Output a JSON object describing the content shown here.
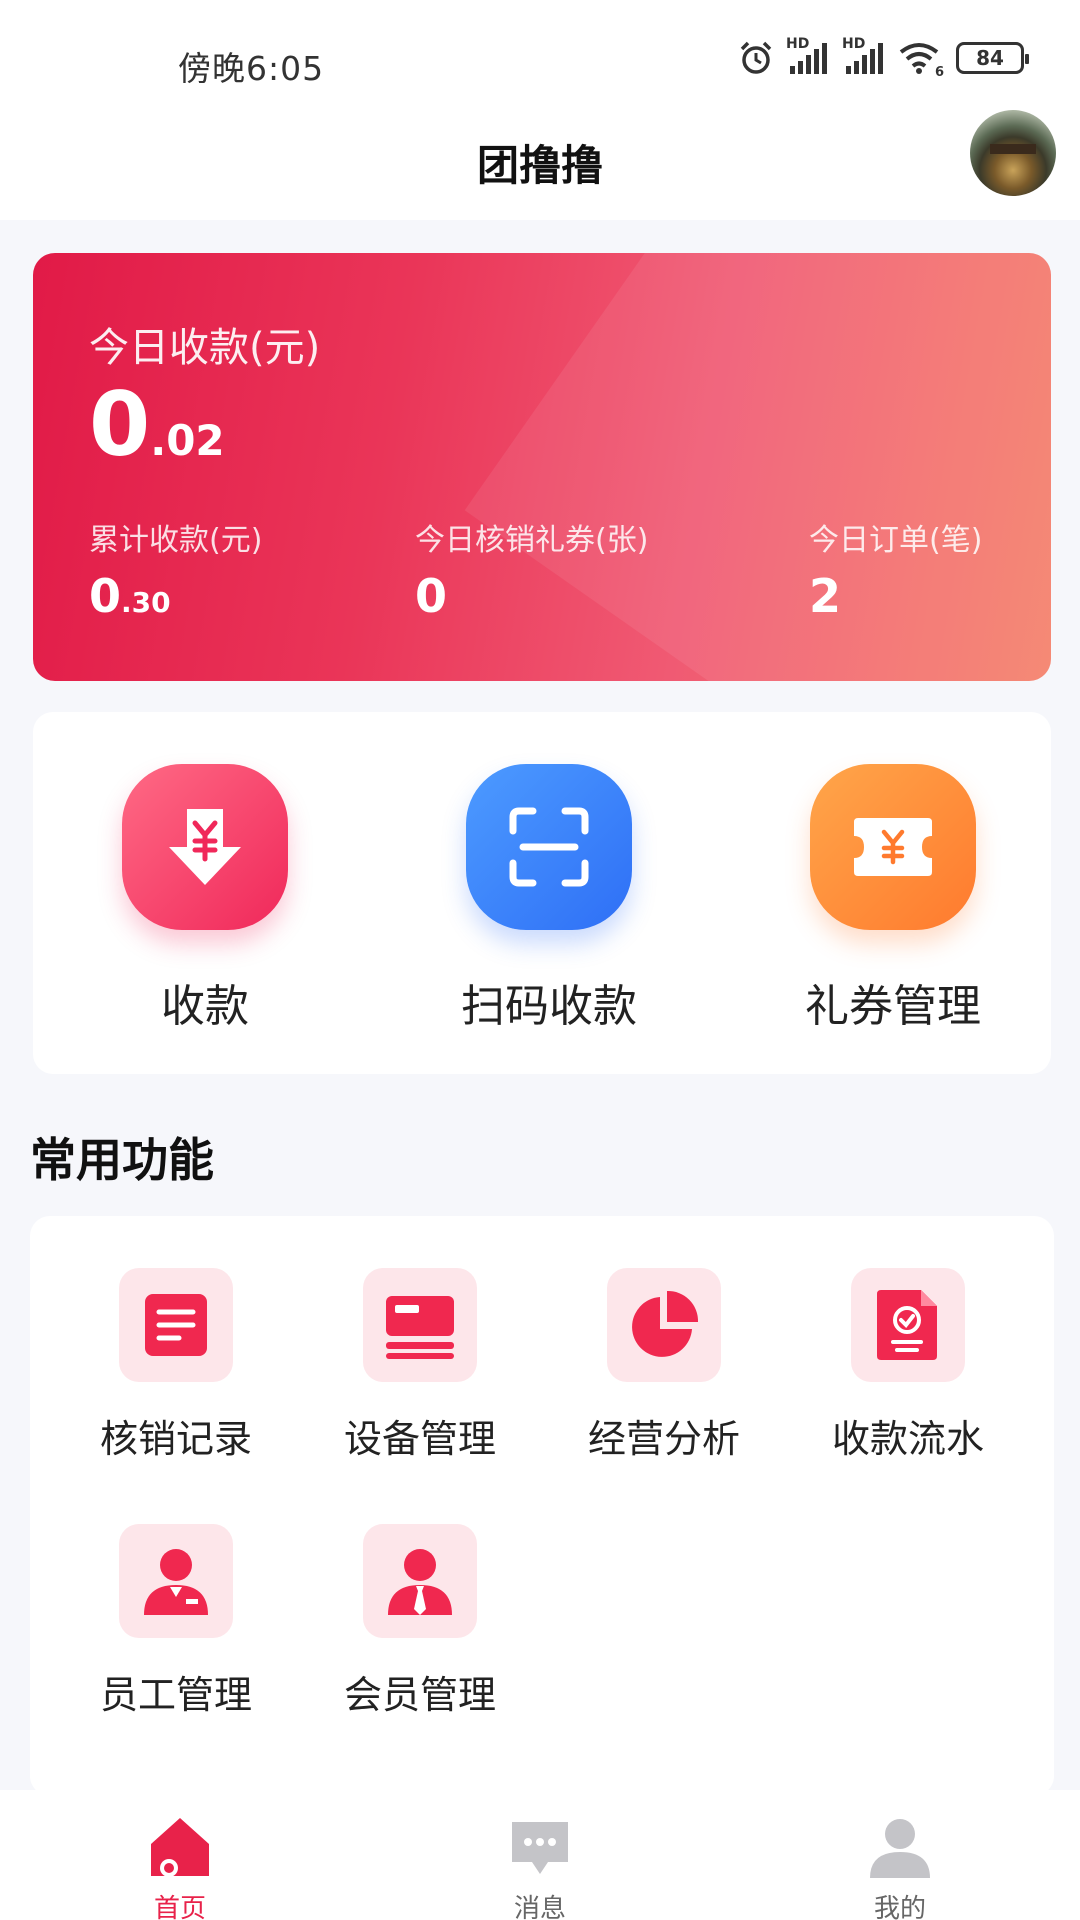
{
  "status_bar": {
    "time": "傍晚6:05",
    "battery": "84",
    "network_label_1": "HD",
    "network_label_2": "HD",
    "wifi_label": "6"
  },
  "header": {
    "title": "团撸撸"
  },
  "revenue": {
    "today_label": "今日收款(元)",
    "today_integer": "0",
    "today_decimal": ".02",
    "stats": [
      {
        "label": "累计收款(元)",
        "integer": "0",
        "decimal": ".30"
      },
      {
        "label": "今日核销礼券(张)",
        "value": "0"
      },
      {
        "label": "今日订单(笔)",
        "value": "2"
      }
    ]
  },
  "quick_actions": [
    {
      "label": "收款",
      "icon": "receive-payment-icon"
    },
    {
      "label": "扫码收款",
      "icon": "scan-icon"
    },
    {
      "label": "礼券管理",
      "icon": "coupon-icon"
    }
  ],
  "section_title": "常用功能",
  "features": [
    {
      "label": "核销记录",
      "icon": "document-icon"
    },
    {
      "label": "设备管理",
      "icon": "card-device-icon"
    },
    {
      "label": "经营分析",
      "icon": "pie-chart-icon"
    },
    {
      "label": "收款流水",
      "icon": "receipt-icon"
    },
    {
      "label": "员工管理",
      "icon": "staff-icon"
    },
    {
      "label": "会员管理",
      "icon": "member-icon"
    }
  ],
  "tab_bar": [
    {
      "label": "首页",
      "icon": "home-icon",
      "active": true
    },
    {
      "label": "消息",
      "icon": "message-icon",
      "active": false
    },
    {
      "label": "我的",
      "icon": "profile-icon",
      "active": false
    }
  ],
  "colors": {
    "accent": "#e8224a",
    "card_gradient_start": "#e11a47",
    "card_gradient_end": "#f5806a",
    "blue": "#2e6ff6",
    "orange": "#ff7a2e",
    "feature_bg": "#fde6ea"
  }
}
